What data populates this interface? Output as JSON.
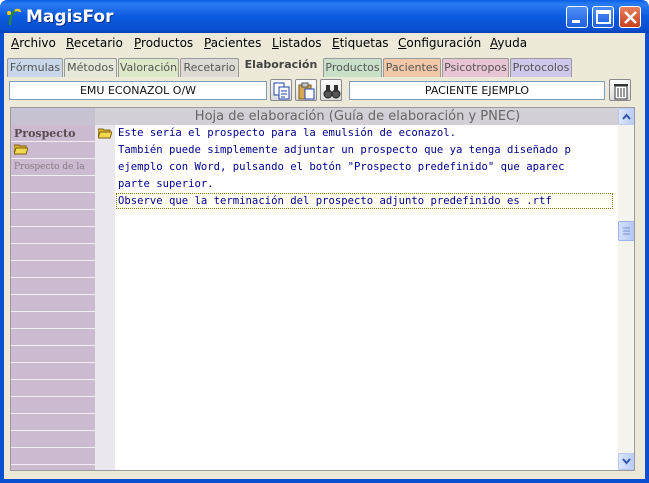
{
  "window": {
    "title": "MagisFor",
    "colors": {
      "titlebar": "#0a5fe8",
      "frame": "#ece9d8",
      "close_button": "#c6401c"
    }
  },
  "menu": {
    "items": [
      {
        "label": "Archivo"
      },
      {
        "label": "Recetario"
      },
      {
        "label": "Productos"
      },
      {
        "label": "Pacientes"
      },
      {
        "label": "Listados"
      },
      {
        "label": "Etiquetas"
      },
      {
        "label": "Configuración"
      },
      {
        "label": "Ayuda"
      }
    ]
  },
  "tabs": [
    {
      "label": "Fórmulas",
      "color": "#c8d8ea"
    },
    {
      "label": "Métodos",
      "color": "#e4e8d8"
    },
    {
      "label": "Valoración",
      "color": "#dde8c8"
    },
    {
      "label": "Recetario",
      "color": "#dcdad2"
    },
    {
      "label": "Elaboración",
      "active": true
    },
    {
      "label": "Productos",
      "color": "#c8e0c8"
    },
    {
      "label": "Pacientes",
      "color": "#f2c8a8"
    },
    {
      "label": "Psicotropos",
      "color": "#e8c4d4"
    },
    {
      "label": "Protocolos",
      "color": "#d0c8ea"
    }
  ],
  "toolbar": {
    "formula_name": "EMU ECONAZOL O/W",
    "patient_name": "PACIENTE EJEMPLO",
    "icons": [
      "copy-icon",
      "paste-icon",
      "binoculars-icon",
      "trash-icon"
    ]
  },
  "panel": {
    "title": "Hoja de elaboración (Guía de elaboración y PNEC)",
    "left_label": "Prospecto",
    "left_sublabel": "Prospecto de la",
    "lines": [
      "Este sería el prospecto para la emulsión de econazol.",
      "También puede simplemente adjuntar un prospecto que ya tenga diseñado p",
      "ejemplo con Word, pulsando el botón \"Prospecto predefinido\" que aparec",
      "parte superior.",
      "Observe que la terminación del prospecto adjunto predefinido es .rtf"
    ]
  }
}
